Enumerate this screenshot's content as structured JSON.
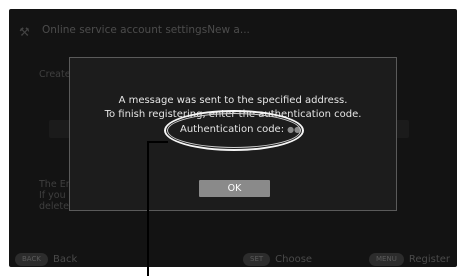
{
  "header": {
    "icon": "tools-icon",
    "title": "Online service account settingsNew a..."
  },
  "background": {
    "line_create": "Create",
    "line_the_en": "The En",
    "line_if_you": "If you",
    "line_delete": "delete"
  },
  "dialog": {
    "line1": "A message was sent to the specified address.",
    "line2": "To finish registering, enter the authentication code.",
    "auth_label": "Authentication code:",
    "auth_dots": "●●",
    "ok_label": "OK"
  },
  "footer": {
    "back_key": "BACK",
    "back_label": "Back",
    "set_key": "SET",
    "set_label": "Choose",
    "menu_key": "MENU",
    "menu_label": "Register"
  },
  "colors": {
    "highlight": "#f5f5f5",
    "ok_button": "#8a8a8a",
    "dialog_border": "#5a5a5a"
  }
}
